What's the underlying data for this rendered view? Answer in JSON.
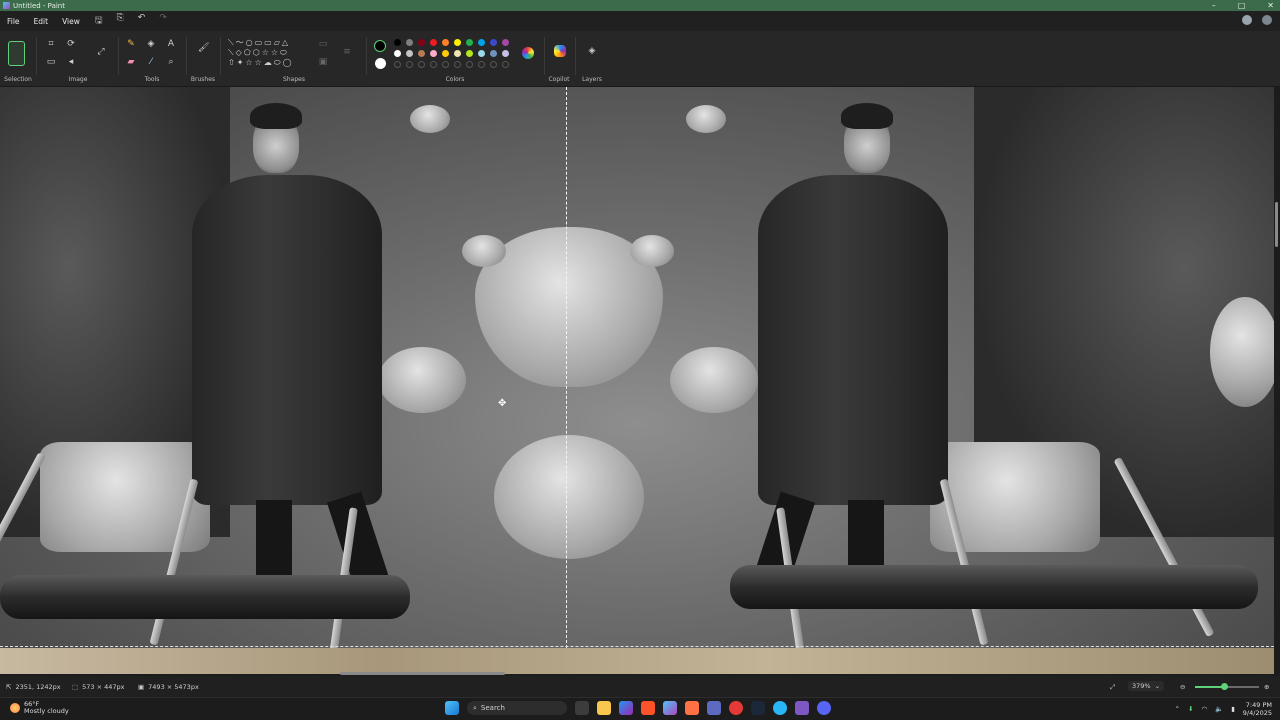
{
  "window": {
    "title": "Untitled - Paint"
  },
  "menu": {
    "file": "File",
    "edit": "Edit",
    "view": "View"
  },
  "ribbon": {
    "selection": "Selection",
    "image": "Image",
    "tools": "Tools",
    "brushes": "Brushes",
    "shapes": "Shapes",
    "colors": "Colors",
    "copilot": "Copilot",
    "layers": "Layers"
  },
  "palette": {
    "primary": "#000000",
    "secondary": "#ffffff",
    "row1": [
      "#000000",
      "#7f7f7f",
      "#880015",
      "#ed1c24",
      "#ff7f27",
      "#fff200",
      "#22b14c",
      "#00a2e8",
      "#3f48cc",
      "#a349a4"
    ],
    "row2": [
      "#ffffff",
      "#c3c3c3",
      "#b97a57",
      "#ffaec9",
      "#ffc90e",
      "#efe4b0",
      "#b5e61d",
      "#99d9ea",
      "#7092be",
      "#c8bfe7"
    ]
  },
  "status": {
    "cursor_pos": "2351, 1242px",
    "selection_size": "573 × 447px",
    "canvas_size": "7493 × 5473px",
    "zoom": "379%",
    "zoom_level_fraction": 0.45
  },
  "taskbar": {
    "weather_temp": "66°F",
    "weather_desc": "Mostly cloudy",
    "search": "Search",
    "time": "7:49 PM",
    "date": "9/4/2025"
  }
}
